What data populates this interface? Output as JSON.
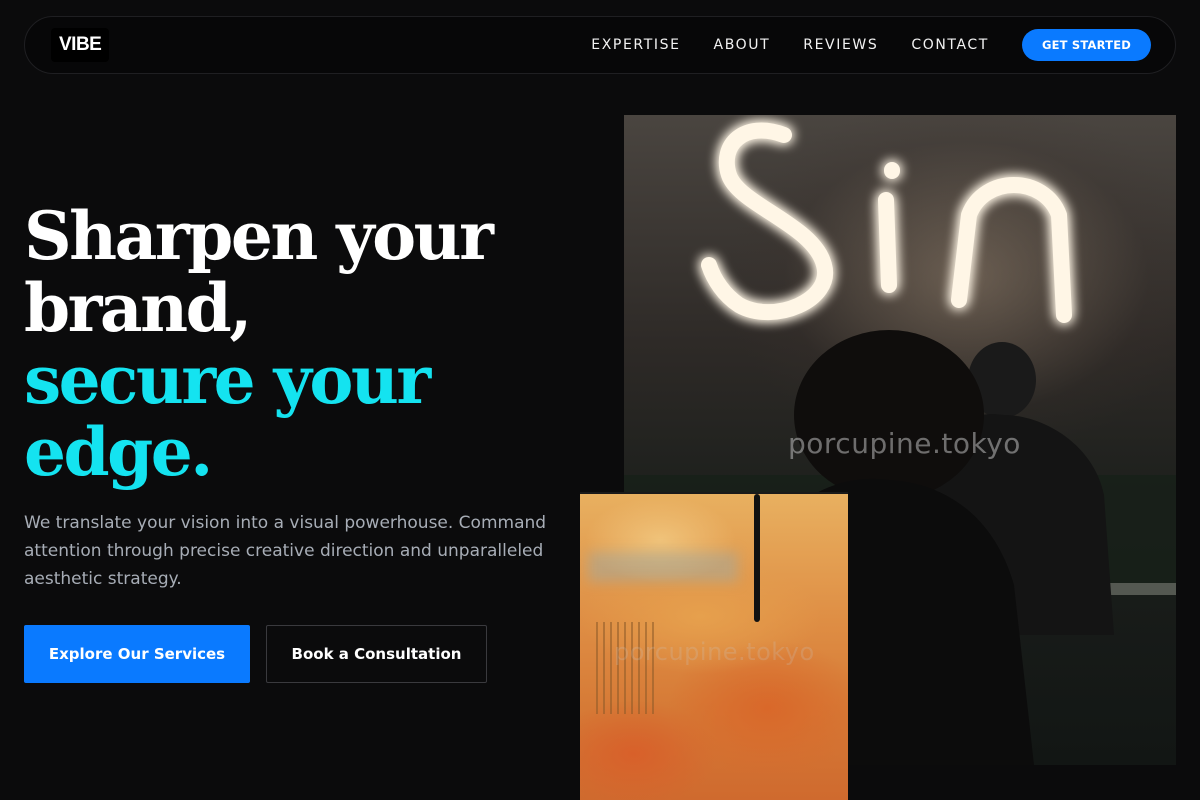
{
  "brand": {
    "logo": "VIBE"
  },
  "nav": {
    "links": [
      "EXPERTISE",
      "ABOUT",
      "REVIEWS",
      "CONTACT"
    ],
    "cta": "GET STARTED"
  },
  "hero": {
    "title_line1": "Sharpen your brand,",
    "title_line2": "secure your edge.",
    "subtitle": "We translate your vision into a visual powerhouse. Command attention through precise creative direction and unparalleled aesthetic strategy.",
    "primary_button": "Explore Our Services",
    "secondary_button": "Book a Consultation"
  },
  "images": {
    "neon_photo_watermark": "porcupine.tokyo",
    "painting_watermark": "porcupine.tokyo",
    "neon_sign_text": "Sin"
  },
  "colors": {
    "accent_blue": "#0a7aff",
    "accent_cyan": "#14e3f0",
    "background": "#0b0b0c"
  }
}
